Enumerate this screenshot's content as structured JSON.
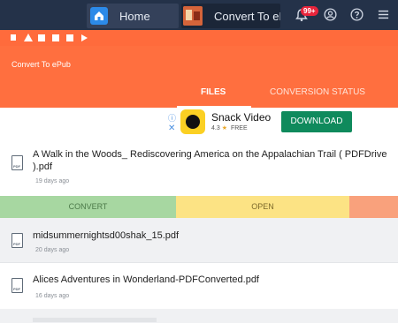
{
  "emulator": {
    "tabs": [
      {
        "label": "Home",
        "icon": "home-icon"
      },
      {
        "label": "Convert To ePub",
        "icon": "app-icon"
      }
    ],
    "notification_badge": "99+",
    "icons": [
      "bell-icon",
      "account-icon",
      "help-icon",
      "menu-icon"
    ]
  },
  "app": {
    "title": "Convert To ePub",
    "tabs": {
      "files": "FILES",
      "conversion_status": "CONVERSION STATUS"
    },
    "accent_color": "#ff6f3f"
  },
  "ad": {
    "info": "ⓘ",
    "close": "✕",
    "name": "Snack Video",
    "rating": "4.3",
    "star": "★",
    "price": "FREE",
    "button": "DOWNLOAD"
  },
  "files": [
    {
      "name": "A Walk in the Woods_ Rediscovering America on the Appalachian Trail ( PDFDrive ).pdf",
      "age": "19 days ago"
    },
    {
      "name": "midsummernightsd00shak_15.pdf",
      "age": "20 days ago"
    },
    {
      "name": "Alices Adventures in Wonderland-PDFConverted.pdf",
      "age": "16 days ago"
    }
  ],
  "actions": {
    "convert": "CONVERT",
    "open": "OPEN"
  }
}
